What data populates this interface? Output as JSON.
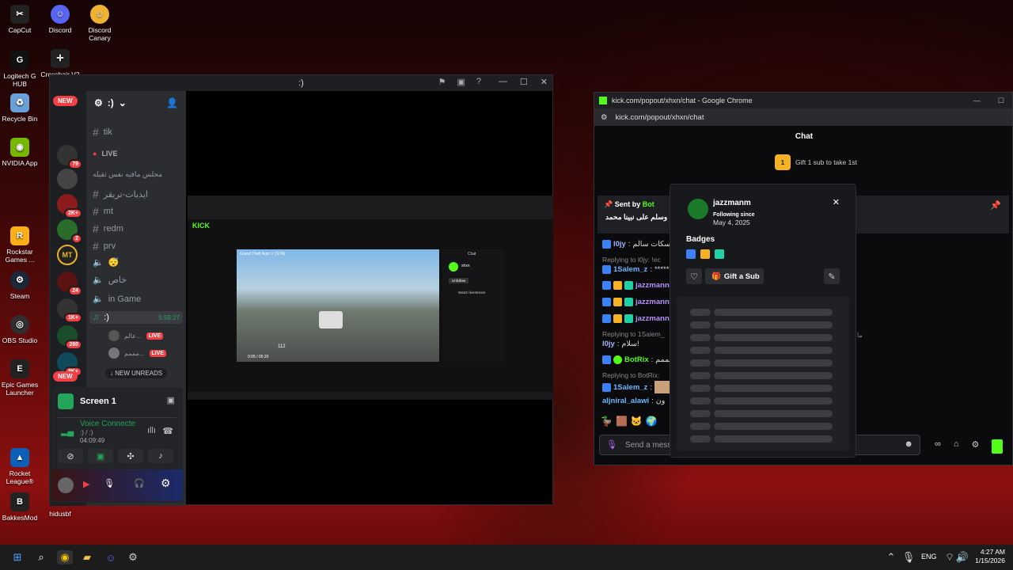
{
  "desktop": {
    "icons": [
      {
        "label": "CapCut",
        "icon": "capcut-icon",
        "color": "#222"
      },
      {
        "label": "Discord",
        "icon": "discord-icon",
        "color": "#5865f2"
      },
      {
        "label": "Discord Canary",
        "icon": "discord-canary-icon",
        "color": "#f0b232"
      },
      {
        "label": "Logitech G HUB",
        "icon": "logitech-icon",
        "color": "#111"
      },
      {
        "label": "Crosshair V2",
        "icon": "crosshair-icon",
        "color": "#222"
      },
      {
        "label": "Recycle Bin",
        "icon": "recycle-bin-icon",
        "color": "#6aa0d8"
      },
      {
        "label": "NVIDIA App",
        "icon": "nvidia-icon",
        "color": "#76b900"
      },
      {
        "label": "Rockstar Games ...",
        "icon": "rockstar-icon",
        "color": "#fcaf17"
      },
      {
        "label": "Steam",
        "icon": "steam-icon",
        "color": "#1b2838"
      },
      {
        "label": "OBS Studio",
        "icon": "obs-icon",
        "color": "#302e31"
      },
      {
        "label": "Epic Games Launcher",
        "icon": "epic-icon",
        "color": "#222"
      },
      {
        "label": "Rocket League®",
        "icon": "rocket-league-icon",
        "color": "#0e5fb8"
      },
      {
        "label": "BakkesMod",
        "icon": "bakkesmod-icon",
        "color": "#222"
      },
      {
        "label": "hidusbf",
        "icon": "hidusbf-icon",
        "color": "#444"
      }
    ]
  },
  "discord": {
    "title": ":)",
    "server_name": ":)",
    "new_label": "NEW",
    "new_unreads": "NEW UNREADS",
    "server_badges": [
      "79",
      "2K+",
      "2",
      "24",
      "1K+",
      "280",
      "9K+"
    ],
    "server_letters": [
      "MT"
    ],
    "channels": [
      {
        "name": "tik",
        "type": "text"
      },
      {
        "name": "LIVE",
        "type": "category"
      },
      {
        "name": "مجلس مافيه نفس ثقيله",
        "type": "category"
      },
      {
        "name": "ايديات-تريقر",
        "type": "text"
      },
      {
        "name": "mt",
        "type": "text"
      },
      {
        "name": "redm",
        "type": "text"
      },
      {
        "name": "prv",
        "type": "text"
      },
      {
        "name": "😴",
        "type": "voice"
      },
      {
        "name": "خاص",
        "type": "voice"
      },
      {
        "name": "in Game",
        "type": "voice"
      },
      {
        "name": ":)",
        "type": "voice-active",
        "timer": "5:58:27"
      }
    ],
    "voice_users": [
      {
        "name": "عالم...",
        "live": "LIVE"
      },
      {
        "name": "مممم...",
        "live": "LIVE"
      }
    ],
    "panel": {
      "screen_title": "Screen 1",
      "voice_status": "Voice Connecte",
      "voice_channel": ":) / :)",
      "voice_timer": "04:09:49",
      "username": "hidusbf"
    },
    "embedded_stream": {
      "site": "KICK",
      "title": "Grand Theft Auto V (GTA)",
      "chat_header": "Chat",
      "channel": "xhxn",
      "unfollow": "Unfollow",
      "watch": "Watch livestream",
      "speed": "112",
      "time": "0:05 / 05:20"
    }
  },
  "chrome": {
    "title": "kick.com/popout/xhxn/chat - Google Chrome",
    "url": "kick.com/popout/xhxn/chat",
    "chat_header": "Chat",
    "gift_goal": "Gift 1 sub to take 1st",
    "gift_rank": "1",
    "pinned": {
      "sent_by": "Sent by",
      "sender": "Bot",
      "text": "ل وسلم على نبينا محمد"
    },
    "messages": [
      {
        "user": "l0jy",
        "text": "صباح اسكات سالم",
        "color": "#9fb4ff"
      },
      {
        "reply": "Replying to l0jy: !ec"
      },
      {
        "user": "1Salem_z",
        "text": "*******",
        "color": "#6fb6ff"
      },
      {
        "user": "jazzmann",
        "text": "",
        "color": "#b591ff"
      },
      {
        "user": "jazzmann",
        "text": "",
        "color": "#b591ff"
      },
      {
        "user": "jazzmann",
        "text": "",
        "color": "#b591ff"
      },
      {
        "reply": "Replying to 1Salem_"
      },
      {
        "user": "l0jy",
        "text": "سلام!",
        "color": "#9fb4ff"
      },
      {
        "user": "BotRix",
        "text": "ظيممم",
        "color": "#53fc18"
      },
      {
        "reply": "Replying to BotRix:"
      },
      {
        "user": "1Salem_z",
        "text": "",
        "color": "#6fb6ff"
      },
      {
        "user": "aljniral_alawi",
        "text": "ون",
        "color": "#6fb6ff"
      }
    ],
    "input_placeholder": "Send a mess",
    "side_note": "ما"
  },
  "user_card": {
    "username": "jazzmanm",
    "following_label": "Following since",
    "following_date": "May 4, 2025",
    "badges_label": "Badges",
    "gift_button": "Gift a Sub"
  },
  "taskbar": {
    "lang": "ENG",
    "time": "4:27 AM",
    "date": "1/15/2026",
    "apps": [
      "windows-start-icon",
      "search-icon",
      "chrome-icon",
      "file-explorer-icon",
      "discord-icon",
      "steam-icon"
    ]
  },
  "colors": {
    "kick_green": "#53fc18",
    "discord_red": "#f23f43",
    "discord_bg": "#2b2d31"
  }
}
